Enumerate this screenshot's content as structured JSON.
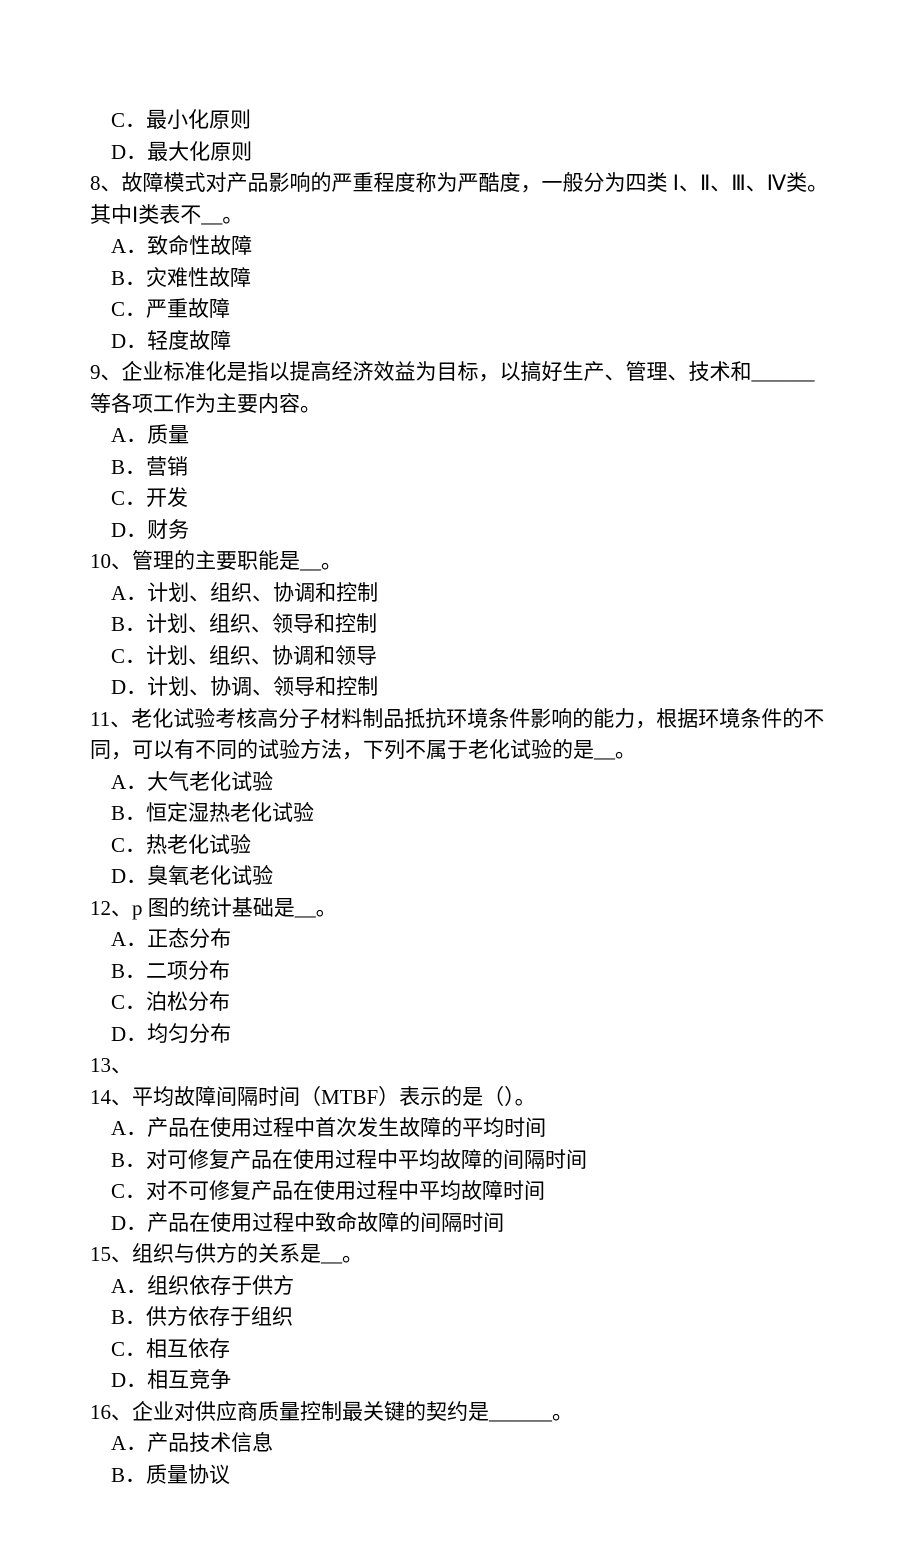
{
  "q7_options": {
    "c": "C．最小化原则",
    "d": "D．最大化原则"
  },
  "q8": {
    "text": "8、故障模式对产品影响的严重程度称为严酷度，一般分为四类 Ⅰ、Ⅱ、Ⅲ、Ⅳ类。其中Ⅰ类表不__。",
    "a": "A．致命性故障",
    "b": "B．灾难性故障",
    "c": "C．严重故障",
    "d": "D．轻度故障"
  },
  "q9": {
    "text": "9、企业标准化是指以提高经济效益为目标，以搞好生产、管理、技术和______等各项工作为主要内容。",
    "a": "A．质量",
    "b": "B．营销",
    "c": "C．开发",
    "d": "D．财务"
  },
  "q10": {
    "text": "10、管理的主要职能是__。",
    "a": "A．计划、组织、协调和控制",
    "b": "B．计划、组织、领导和控制",
    "c": "C．计划、组织、协调和领导",
    "d": "D．计划、协调、领导和控制"
  },
  "q11": {
    "text": "11、老化试验考核高分子材料制品抵抗环境条件影响的能力，根据环境条件的不同，可以有不同的试验方法，下列不属于老化试验的是__。",
    "a": "A．大气老化试验",
    "b": "B．恒定湿热老化试验",
    "c": "C．热老化试验",
    "d": "D．臭氧老化试验"
  },
  "q12": {
    "text": "12、p 图的统计基础是__。",
    "a": "A．正态分布",
    "b": "B．二项分布",
    "c": "C．泊松分布",
    "d": "D．均匀分布"
  },
  "q13": {
    "text": "13、"
  },
  "q14": {
    "text": "14、平均故障间隔时间（MTBF）表示的是（）。",
    "a": "A．产品在使用过程中首次发生故障的平均时间",
    "b": "B．对可修复产品在使用过程中平均故障的间隔时间",
    "c": "C．对不可修复产品在使用过程中平均故障时间",
    "d": "D．产品在使用过程中致命故障的间隔时间"
  },
  "q15": {
    "text": "15、组织与供方的关系是__。",
    "a": "A．组织依存于供方",
    "b": "B．供方依存于组织",
    "c": "C．相互依存",
    "d": "D．相互竞争"
  },
  "q16": {
    "text": "16、企业对供应商质量控制最关键的契约是______。",
    "a": "A．产品技术信息",
    "b": "B．质量协议"
  }
}
